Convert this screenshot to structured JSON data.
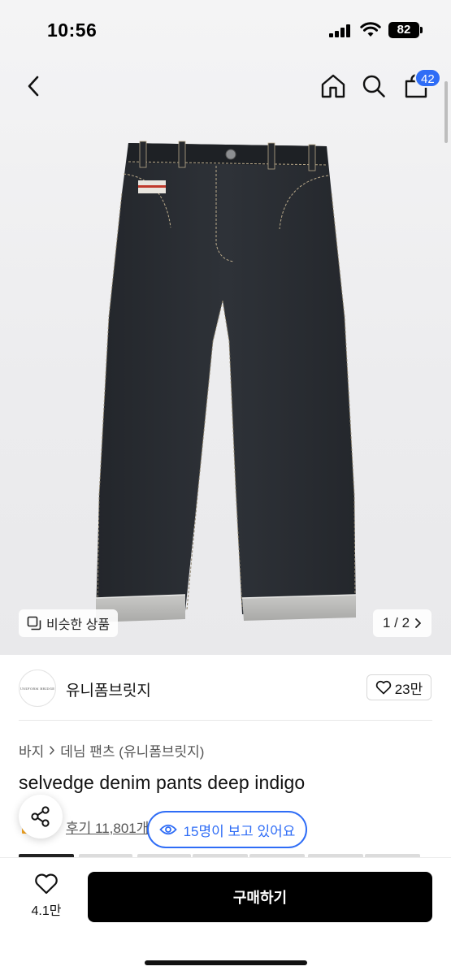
{
  "status_bar": {
    "time": "10:56",
    "battery": "82"
  },
  "nav": {
    "cart_badge": "42"
  },
  "gallery": {
    "similar_label": "비슷한 상품",
    "page_indicator": "1 / 2"
  },
  "brand": {
    "name": "유니폼브릿지",
    "logo_text": "UNIFORM BRIDGE",
    "likes": "23만"
  },
  "breadcrumb": [
    "바지",
    "데님 팬츠 (유니폼브릿지)"
  ],
  "product": {
    "title": "selvedge denim pants deep indigo",
    "review_link": "후기 11,801개",
    "viewers": "15명이 보고 있어요"
  },
  "bottom_bar": {
    "wish_count": "4.1만",
    "buy_label": "구매하기"
  },
  "colors": {
    "accent": "#2f6df6",
    "buy_button": "#000000",
    "denim": "#2a2d33"
  },
  "icons": [
    "back-icon",
    "home-icon",
    "search-icon",
    "shopping-bag-icon",
    "similar-items-icon",
    "chevron-right-icon",
    "heart-icon",
    "share-icon",
    "eye-icon"
  ]
}
